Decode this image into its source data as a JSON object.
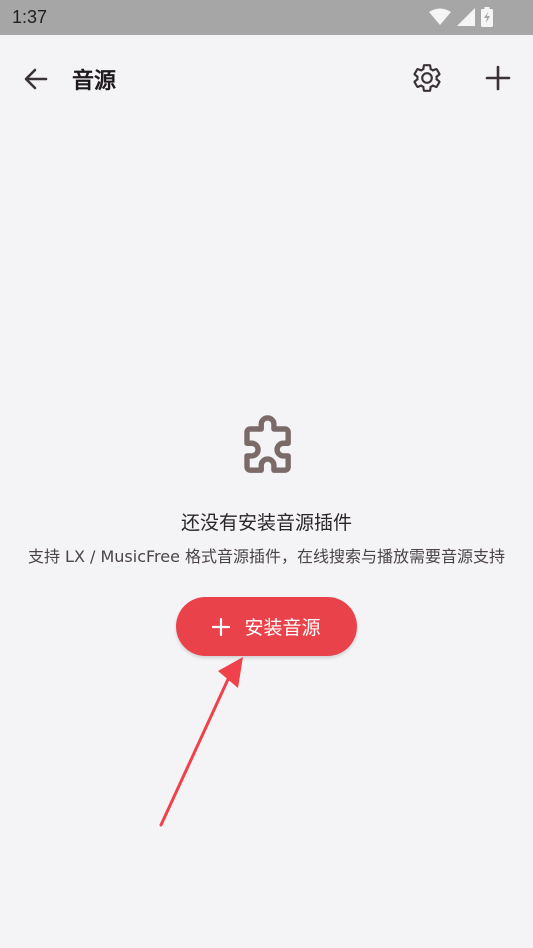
{
  "status_bar": {
    "time": "1:37",
    "icons": [
      "wifi-icon",
      "signal-icon",
      "battery-charging-icon"
    ]
  },
  "app_bar": {
    "title": "音源",
    "icons": {
      "back": "arrow-left-icon",
      "settings": "gear-icon",
      "add": "plus-icon"
    }
  },
  "empty_state": {
    "icon": "puzzle-icon",
    "title": "还没有安装音源插件",
    "subtitle": "支持 LX / MusicFree 格式音源插件，在线搜索与播放需要音源支持",
    "install_button_label": "安装音源",
    "install_button_icon": "plus-icon"
  },
  "colors": {
    "background": "#f4f3f6",
    "accent": "#e9424a",
    "icon_muted": "#7a6b68",
    "annotation_arrow": "#f0424a"
  }
}
